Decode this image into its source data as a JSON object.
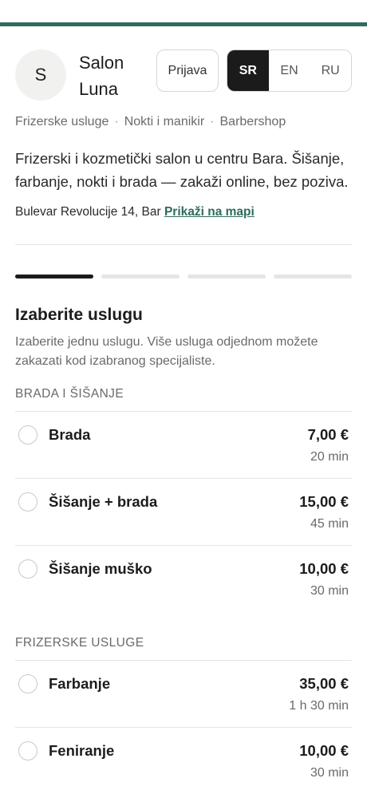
{
  "header": {
    "avatar_letter": "S",
    "salon_name": "Salon Luna",
    "login_label": "Prijava",
    "languages": [
      {
        "label": "SR",
        "active": true
      },
      {
        "label": "EN",
        "active": false
      },
      {
        "label": "RU",
        "active": false
      }
    ]
  },
  "categories": [
    "Frizerske usluge",
    "Nokti i manikir",
    "Barbershop"
  ],
  "category_separator": "·",
  "description": "Frizerski i kozmetički salon u centru Bara. Šišanje, farbanje, nokti i brada — zakaži online, bez poziva.",
  "address": {
    "text": "Bulevar Revolucije 14, Bar",
    "map_link": "Prikaži na mapi"
  },
  "steps": {
    "total": 4,
    "current": 1
  },
  "service_section": {
    "title": "Izaberite uslugu",
    "subtitle": "Izaberite jednu uslugu. Više usluga odjednom možete zakazati kod izabranog specijaliste."
  },
  "groups": [
    {
      "title": "BRADA I ŠIŠANJE",
      "services": [
        {
          "name": "Brada",
          "price": "7,00 €",
          "duration": "20 min"
        },
        {
          "name": "Šišanje + brada",
          "price": "15,00 €",
          "duration": "45 min"
        },
        {
          "name": "Šišanje muško",
          "price": "10,00 €",
          "duration": "30 min"
        }
      ]
    },
    {
      "title": "FRIZERSKE USLUGE",
      "services": [
        {
          "name": "Farbanje",
          "price": "35,00 €",
          "duration": "1 h 30 min"
        },
        {
          "name": "Feniranje",
          "price": "10,00 €",
          "duration": "30 min"
        }
      ]
    }
  ],
  "colors": {
    "accent": "#2f6b5e",
    "active_lang_bg": "#1b1b1b",
    "muted_text": "#6a6a6a",
    "divider": "#e4e4e4"
  }
}
